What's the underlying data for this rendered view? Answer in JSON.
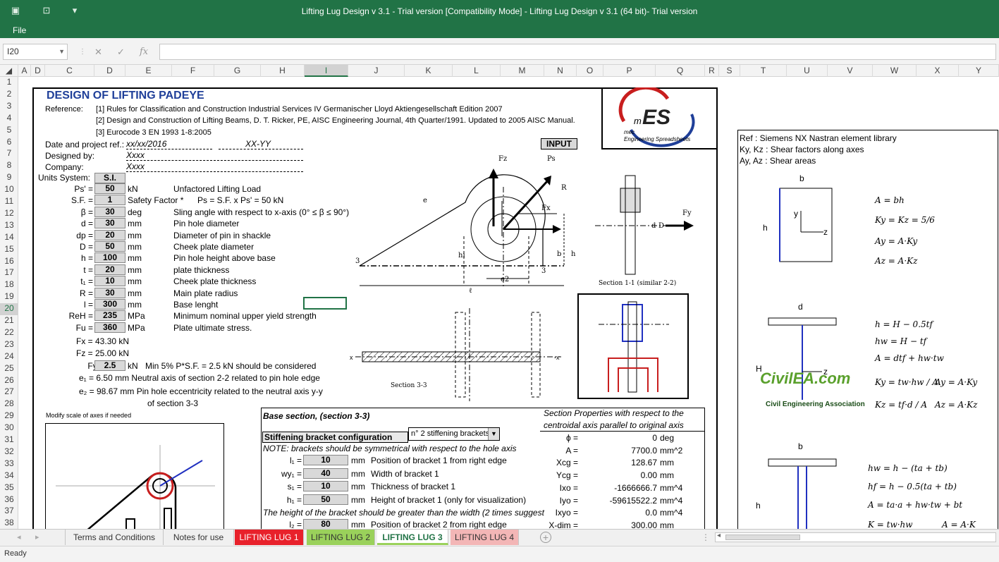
{
  "window": {
    "title": "Lifting Lug Design v 3.1 - Trial version  [Compatibility Mode] - Lifting Lug Design v 3.1 (64 bit)- Trial version"
  },
  "ribbon": {
    "file_label": "File"
  },
  "formula_bar": {
    "name_box": "I20",
    "cancel": "✕",
    "enter": "✓",
    "fx": "fx",
    "content": ""
  },
  "columns": [
    "A",
    "D",
    "C",
    "D",
    "E",
    "F",
    "G",
    "H",
    "I",
    "J",
    "K",
    "L",
    "M",
    "N",
    "O",
    "P",
    "Q",
    "R",
    "S",
    "T",
    "U",
    "V",
    "W",
    "X",
    "Y"
  ],
  "selected_column": "I",
  "rows": [
    "1",
    "2",
    "3",
    "4",
    "5",
    "6",
    "7",
    "8",
    "9",
    "10",
    "11",
    "12",
    "13",
    "14",
    "15",
    "16",
    "17",
    "18",
    "19",
    "20",
    "21",
    "22",
    "23",
    "24",
    "25",
    "26",
    "27",
    "28",
    "29",
    "30",
    "31",
    "32",
    "33",
    "34",
    "35",
    "36",
    "37",
    "38"
  ],
  "selected_row": "20",
  "sheet": {
    "title": "DESIGN OF LIFTING PADEYE",
    "ref_label": "Reference:",
    "ref1": "[1] Rules for Classification and Construction Industrial Services IV Germanischer Lloyd Aktiengesellschaft Edition 2007",
    "ref2": "[2] Design and Construction of Lifting Beams, D. T. Ricker, PE, AISC Engineering Journal, 4th Quarter/1991. Updated to 2005 AISC Manual.",
    "ref3": "[3] Eurocode 3 EN 1993 1-8:2005",
    "date_label": "Date and project ref.:",
    "date_val": "xx/xx/2016",
    "proj_val": "XX-YY",
    "designed_label": "Designed by:",
    "designed_val": "Xxxx",
    "company_label": "Company:",
    "company_val": "Xxxx",
    "input_label": "INPUT",
    "logo": {
      "text": "mES",
      "sub1": "mec",
      "sub2": "Engineering Spreadsheets"
    },
    "units_label": "Units System:",
    "units_val": "S.I.",
    "params": [
      {
        "sym": "Ps' =",
        "val": "50",
        "unit": "kN",
        "desc": "Unfactored Lifting Load"
      },
      {
        "sym": "S.F. =",
        "val": "1",
        "unit": "Safety Factor *",
        "desc": "Ps = S.F. x Ps' =            50  kN"
      },
      {
        "sym": "β =",
        "val": "30",
        "unit": "deg",
        "desc": "Sling angle with respect to x-axis (0° ≤ β ≤ 90°)"
      },
      {
        "sym": "d =",
        "val": "30",
        "unit": "mm",
        "desc": "Pin hole diameter"
      },
      {
        "sym": "dp =",
        "val": "20",
        "unit": "mm",
        "desc": "Diameter of pin in shackle"
      },
      {
        "sym": "D =",
        "val": "50",
        "unit": "mm",
        "desc": "Cheek plate diameter"
      },
      {
        "sym": "h =",
        "val": "100",
        "unit": "mm",
        "desc": "Pin hole height above base"
      },
      {
        "sym": "t =",
        "val": "20",
        "unit": "mm",
        "desc": "plate thickness"
      },
      {
        "sym": "t₁ =",
        "val": "10",
        "unit": "mm",
        "desc": "Cheek plate thickness"
      },
      {
        "sym": "R =",
        "val": "30",
        "unit": "mm",
        "desc": "Main plate radius"
      },
      {
        "sym": "l =",
        "val": "300",
        "unit": "mm",
        "desc": "Base lenght"
      },
      {
        "sym": "ReH =",
        "val": "235",
        "unit": "MPa",
        "desc": "Minimum nominal upper yield strength"
      },
      {
        "sym": "Fu =",
        "val": "360",
        "unit": "MPa",
        "desc": "Plate ultimate stress."
      }
    ],
    "fx": "Fx =    43.30  kN",
    "fz": "Fz =    25.00  kN",
    "fy_sym": "Fy =",
    "fy_val": "2.5",
    "fy_unit": "kN",
    "fy_desc": "Min 5% P*S.F. = 2.5 kN should be considered",
    "e1": "e₁ =      6.50  mm   Neutral axis of section 2-2 related to pin hole edge",
    "e2": "e₂ =    98.67  mm   Pin hole eccentricity related to the neutral axis y-y",
    "e2b": "of section 3-3",
    "modify_note": "Modify scale of axes if needed",
    "sec11_caption": "Section 1-1 (similar 2-2)",
    "sec33_caption": "Section 3-3",
    "base_title": "Base section, (section 3-3)",
    "props_title1": "Section Properties with respect to the",
    "props_title2": "centroidal axis parallel to original axis",
    "stiff_label": "Stiffening bracket configuration",
    "stiff_select": "n° 2 stiffening brackets",
    "note": "NOTE: brackets should be symmetrical with respect to the hole axis",
    "brackets": [
      {
        "sym": "l₁ =",
        "val": "10",
        "unit": "mm",
        "desc": "Position of bracket 1 from right edge"
      },
      {
        "sym": "wy₁ =",
        "val": "40",
        "unit": "mm",
        "desc": "Width of bracket 1"
      },
      {
        "sym": "s₁ =",
        "val": "10",
        "unit": "mm",
        "desc": "Thickness of bracket 1"
      },
      {
        "sym": "h₁ =",
        "val": "50",
        "unit": "mm",
        "desc": "Height of bracket 1 (only for visualization)"
      }
    ],
    "bracket_note": "The height of the bracket should be greater than the width (2 times suggest",
    "bracket2": {
      "sym": "l₂ =",
      "val": "80",
      "unit": "mm",
      "desc": "Position of bracket 2 from right edge"
    },
    "props": [
      {
        "sym": "ϕ =",
        "val": "0",
        "unit": "deg"
      },
      {
        "sym": "A =",
        "val": "7700.0",
        "unit": "mm^2"
      },
      {
        "sym": "Xcg =",
        "val": "128.67",
        "unit": "mm"
      },
      {
        "sym": "Ycg =",
        "val": "0.00",
        "unit": "mm"
      },
      {
        "sym": "Ixo =",
        "val": "-1666666.7",
        "unit": "mm^4"
      },
      {
        "sym": "Iyo =",
        "val": "-59615522.2",
        "unit": "mm^4"
      },
      {
        "sym": "Ixyo =",
        "val": "0.0",
        "unit": "mm^4"
      },
      {
        "sym": "X-dim =",
        "val": "300.00",
        "unit": "mm"
      }
    ],
    "side": {
      "ref": "Ref : Siemens NX Nastran element library",
      "k": "Ky, Kz : Shear factors along axes",
      "a": "Ay, Az : Shear areas",
      "f1": "A = bh",
      "f2": "Ky = Kz = 5/6",
      "f3": "Ay = A·Ky",
      "f4": "Az = A·Kz",
      "g1": "h = H − 0.5tf",
      "g2": "hw = H − tf",
      "g3": "A = dtf + hw·tw",
      "g4": "Ky = tw·hw / A",
      "g5": "Ay = A·Ky",
      "g6": "Kz = tf·d / A",
      "g7": "Az = A·Kz",
      "h1": "hw = h − (ta + tb)",
      "h2": "hf = h − 0.5(ta + tb)",
      "h3": "A = ta·a + hw·tw + bt",
      "h4": "K = tw·hw",
      "h5": "A = A·K"
    },
    "watermark1": "CivilEA.com",
    "watermark2": "Civil Engineering Association"
  },
  "tabs": [
    "Terms and Conditions",
    "Notes for use",
    "LIFTING LUG 1",
    "LIFTING LUG 2",
    "LIFTING LUG 3",
    "LIFTING LUG 4"
  ],
  "active_tab": "LIFTING LUG 3",
  "status": "Ready",
  "colors": {
    "excel_green": "#217346",
    "title_blue": "#1f3f99",
    "tab1": "#e8212b",
    "tab2": "#9ad15b",
    "tab4": "#f3b6b6"
  }
}
